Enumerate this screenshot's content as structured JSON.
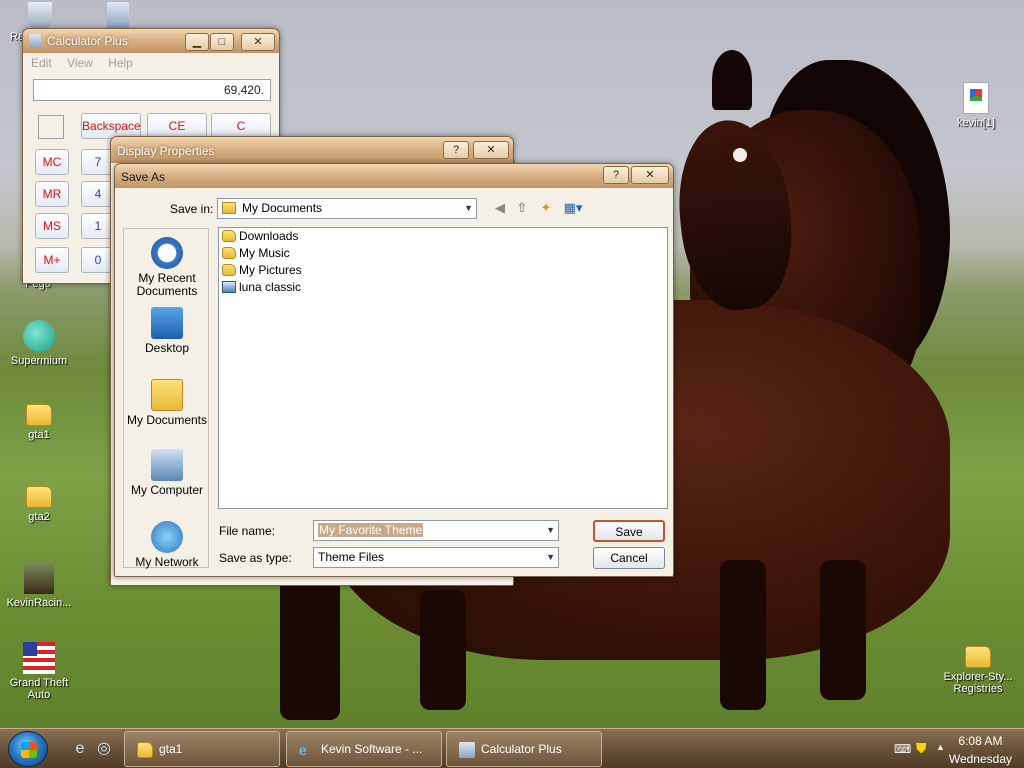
{
  "desktop": {
    "icons": [
      {
        "label": "Re",
        "icon": "recycle-bin-icon"
      },
      {
        "label": "",
        "icon": "calculator-icon"
      },
      {
        "label": "kevin[1]",
        "icon": "image-file-icon"
      },
      {
        "label": "Pego",
        "icon": "app-icon"
      },
      {
        "label": "Supermium",
        "icon": "supermium-icon"
      },
      {
        "label": "gta1",
        "icon": "folder-icon"
      },
      {
        "label": "gta2",
        "icon": "folder-icon"
      },
      {
        "label": "KevinRacin...",
        "icon": "horse-image-icon"
      },
      {
        "label": "Grand Theft Auto",
        "icon": "flag-icon"
      },
      {
        "label": "Explorer-Sty... Registries",
        "icon": "folder-icon"
      }
    ]
  },
  "calculator": {
    "title": "Calculator Plus",
    "menu": [
      "Edit",
      "View",
      "Help"
    ],
    "display": "69,420.",
    "buttons": {
      "backspace": "Backspace",
      "ce": "CE",
      "c": "C",
      "mc": "MC",
      "mr": "MR",
      "ms": "MS",
      "mplus": "M+",
      "n7": "7",
      "n4": "4",
      "n1": "1",
      "n0": "0"
    }
  },
  "display_properties": {
    "title": "Display Properties",
    "help": "?",
    "close": "✕"
  },
  "save_as": {
    "title": "Save As",
    "help": "?",
    "close": "✕",
    "save_in_label": "Save in:",
    "save_in_value": "My Documents",
    "places": [
      "My Recent Documents",
      "Desktop",
      "My Documents",
      "My Computer",
      "My Network"
    ],
    "files": [
      "Downloads",
      "My Music",
      "My Pictures",
      "luna classic"
    ],
    "file_name_label": "File name:",
    "file_name_value": "My Favorite Theme",
    "save_type_label": "Save as type:",
    "save_type_value": "Theme Files",
    "save_button": "Save",
    "cancel_button": "Cancel"
  },
  "taskbar": {
    "tasks": [
      "gta1",
      "Kevin Software - ...",
      "Calculator Plus"
    ],
    "time": "6:08 AM",
    "day": "Wednesday"
  }
}
